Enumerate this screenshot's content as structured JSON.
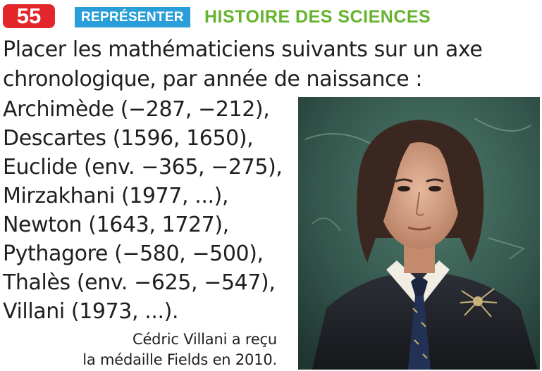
{
  "exercise": {
    "number": "55",
    "tag": "REPRÉSENTER",
    "topic": "HISTOIRE DES SCIENCES"
  },
  "instructions": "Placer les mathématiciens suivants sur un axe chronologique, par année de naissance :",
  "mathematicians": [
    "Archimède (−287, −212),",
    "Descartes (1596, 1650),",
    "Euclide (env. −365, −275),",
    "Mirzakhani (1977, ...),",
    "Newton (1643, 1727),",
    "Pythagore (−580, −500),",
    "Thalès (env. −625, −547),",
    "Villani (1973, ...)."
  ],
  "caption": {
    "line1": "Cédric Villani a reçu",
    "line2": "la médaille Fields en 2010."
  },
  "colors": {
    "badge": "#e3262b",
    "tag": "#2a9ed8",
    "topic": "#66b32e"
  }
}
